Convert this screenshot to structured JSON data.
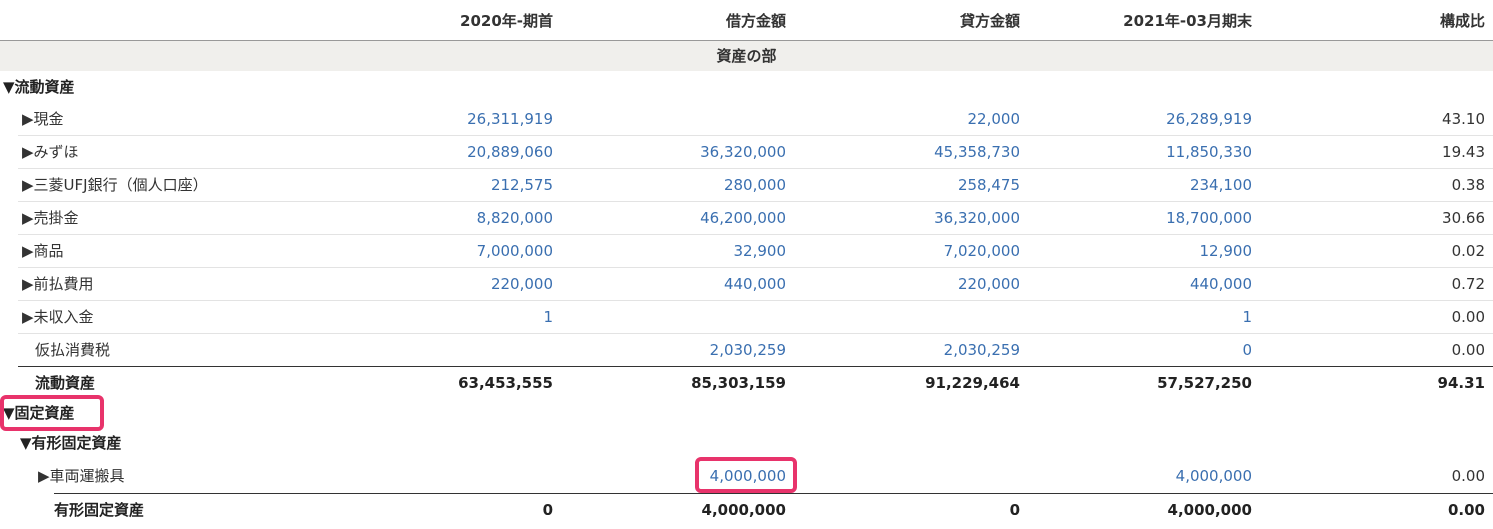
{
  "columns": [
    "2020年-期首",
    "借方金額",
    "貸方金額",
    "2021年-03月期末",
    "構成比"
  ],
  "section_title": "資産の部",
  "current_assets": {
    "heading": "▼流動資産",
    "rows": [
      {
        "label": "▶現金",
        "v1": "26,311,919",
        "v2": "",
        "v3": "22,000",
        "v4": "26,289,919",
        "v5": "43.10"
      },
      {
        "label": "▶みずほ",
        "v1": "20,889,060",
        "v2": "36,320,000",
        "v3": "45,358,730",
        "v4": "11,850,330",
        "v5": "19.43"
      },
      {
        "label": "▶三菱UFJ銀行（個人口座）",
        "v1": "212,575",
        "v2": "280,000",
        "v3": "258,475",
        "v4": "234,100",
        "v5": "0.38"
      },
      {
        "label": "▶売掛金",
        "v1": "8,820,000",
        "v2": "46,200,000",
        "v3": "36,320,000",
        "v4": "18,700,000",
        "v5": "30.66"
      },
      {
        "label": "▶商品",
        "v1": "7,000,000",
        "v2": "32,900",
        "v3": "7,020,000",
        "v4": "12,900",
        "v5": "0.02"
      },
      {
        "label": "▶前払費用",
        "v1": "220,000",
        "v2": "440,000",
        "v3": "220,000",
        "v4": "440,000",
        "v5": "0.72"
      },
      {
        "label": "▶未収入金",
        "v1": "1",
        "v2": "",
        "v3": "",
        "v4": "1",
        "v5": "0.00"
      },
      {
        "label": "仮払消費税",
        "v1": "",
        "v2": "2,030,259",
        "v3": "2,030,259",
        "v4": "0",
        "v5": "0.00"
      }
    ],
    "total": {
      "label": "流動資産",
      "v1": "63,453,555",
      "v2": "85,303,159",
      "v3": "91,229,464",
      "v4": "57,527,250",
      "v5": "94.31"
    }
  },
  "fixed_assets": {
    "heading": "▼固定資産",
    "sub_heading": "▼有形固定資産",
    "rows": [
      {
        "label": "▶車両運搬具",
        "v1": "",
        "v2": "4,000,000",
        "v3": "",
        "v4": "4,000,000",
        "v5": "0.00"
      }
    ],
    "total": {
      "label": "有形固定資産",
      "v1": "0",
      "v2": "4,000,000",
      "v3": "0",
      "v4": "4,000,000",
      "v5": "0.00"
    }
  }
}
